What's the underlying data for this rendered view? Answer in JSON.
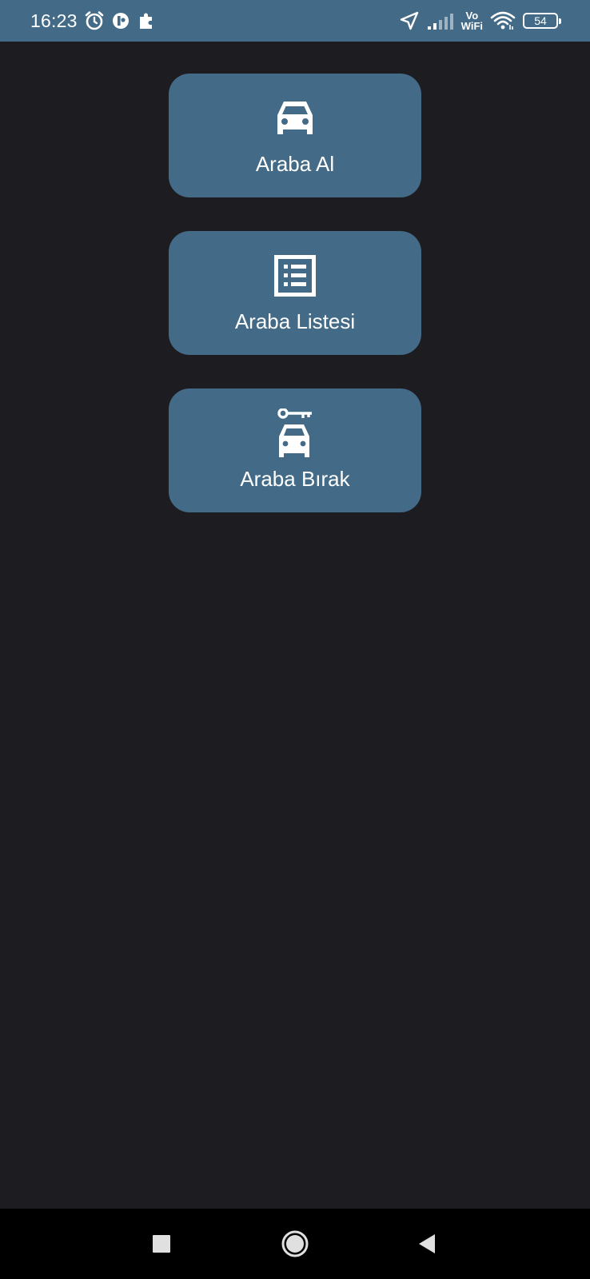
{
  "status_bar": {
    "time": "16:23",
    "vo_label": "Vo",
    "wifi_label": "WiFi",
    "battery_level": "54",
    "icons": [
      "alarm-icon",
      "app-notification-icon",
      "puzzle-icon",
      "location-arrow-icon",
      "signal-icon",
      "wifi-icon",
      "battery-icon"
    ]
  },
  "menu": {
    "items": [
      {
        "label": "Araba Al",
        "icon": "car-icon"
      },
      {
        "label": "Araba Listesi",
        "icon": "list-icon"
      },
      {
        "label": "Araba Bırak",
        "icon": "car-key-icon"
      }
    ]
  },
  "nav_bar": {
    "buttons": [
      "recents-button",
      "home-button",
      "back-button"
    ]
  },
  "colors": {
    "status_bar_bg": "#436a86",
    "card_bg": "#436a86",
    "screen_bg": "#1d1c21",
    "nav_bg": "#000000",
    "text": "#ffffff"
  }
}
